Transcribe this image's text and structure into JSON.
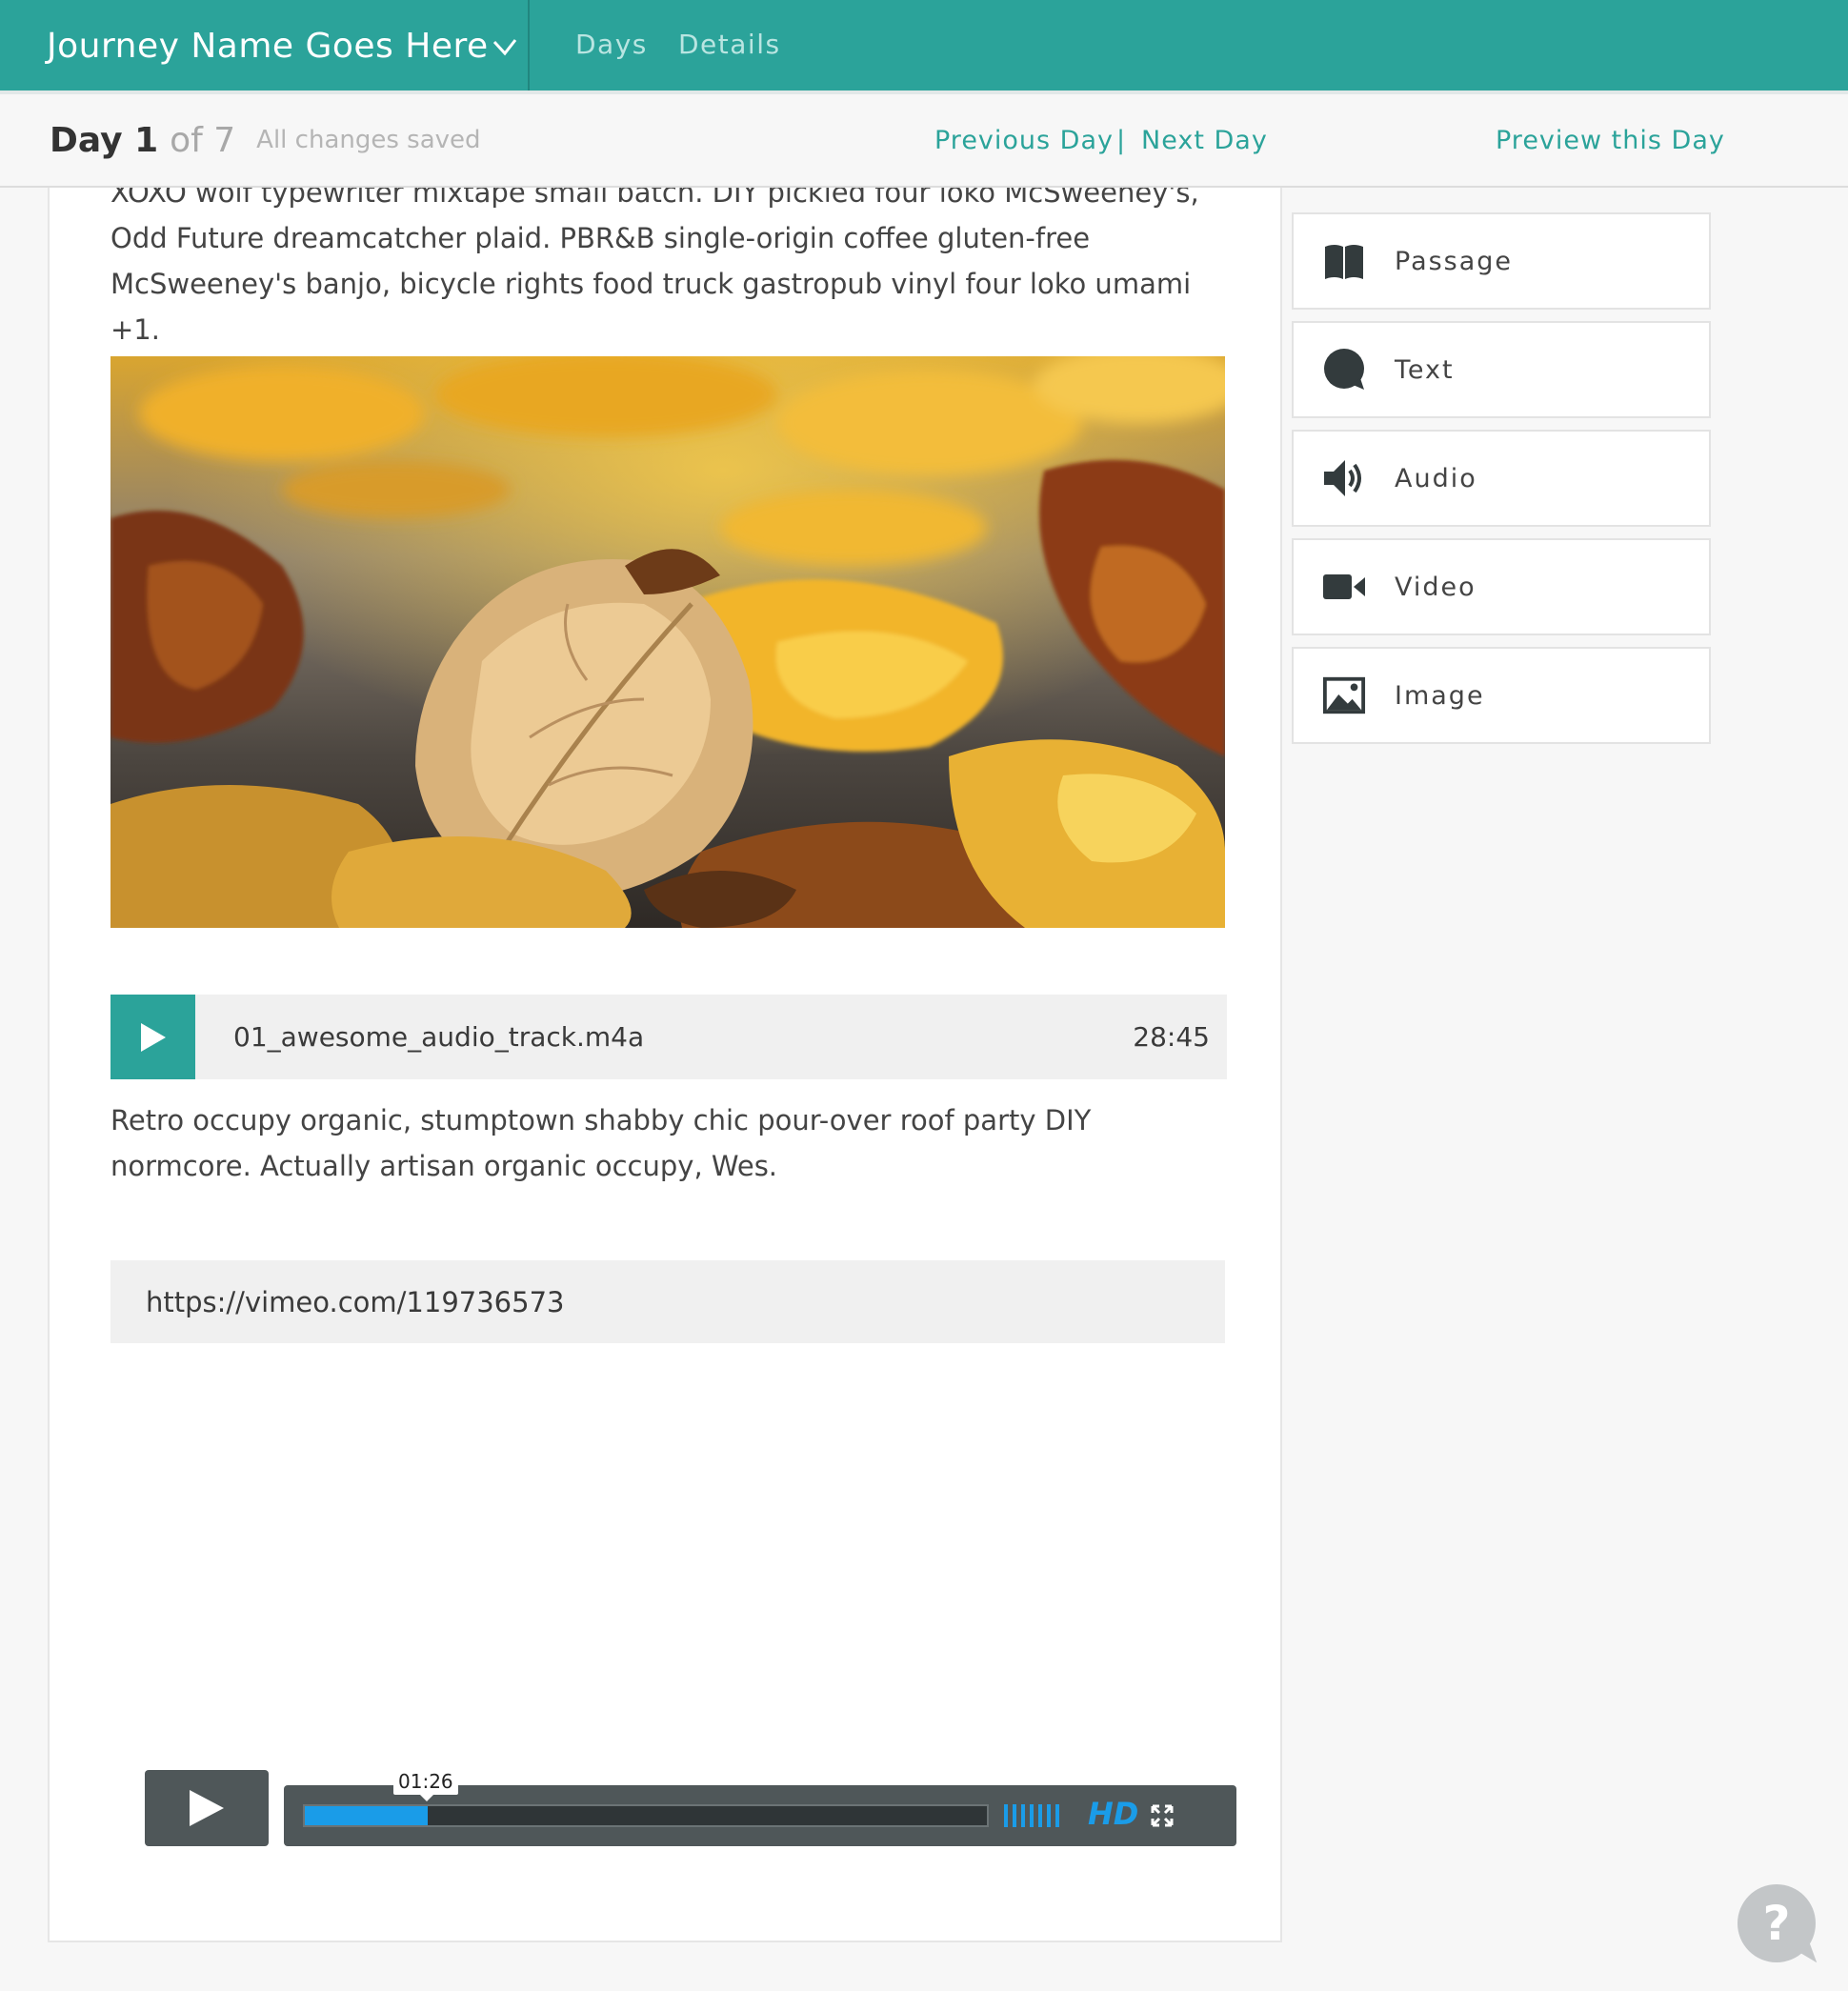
{
  "header": {
    "journey_name": "Journey Name Goes Here",
    "nav": {
      "days": "Days",
      "details": "Details"
    }
  },
  "subheader": {
    "day_label": "Day 1",
    "of_label": "of 7",
    "save_status": "All changes saved",
    "previous_day": "Previous Day",
    "separator": "|",
    "next_day": "Next Day",
    "preview": "Preview this Day"
  },
  "content": {
    "paragraph_1": "XOXO wolf typewriter mixtape small batch. DIY pickled four loko McSweeney's, Odd Future dreamcatcher plaid. PBR&B single-origin coffee gluten-free McSweeney's banjo, bicycle rights food truck gastropub vinyl four loko umami +1.",
    "audio": {
      "filename": "01_awesome_audio_track.m4a",
      "duration": "28:45"
    },
    "paragraph_2": "Retro occupy organic, stumptown shabby chic pour-over roof party DIY normcore. Actually artisan organic occupy, Wes.",
    "video_url": "https://vimeo.com/119736573",
    "video_player": {
      "current_time": "01:26",
      "progress": 0.18,
      "hd_label": "HD"
    }
  },
  "sidebar": {
    "blocks": [
      {
        "label": "Passage",
        "icon": "book-icon"
      },
      {
        "label": "Text",
        "icon": "speech-bubble-icon"
      },
      {
        "label": "Audio",
        "icon": "speaker-icon"
      },
      {
        "label": "Video",
        "icon": "video-camera-icon"
      },
      {
        "label": "Image",
        "icon": "image-icon"
      }
    ]
  },
  "help": {
    "label": "?"
  },
  "colors": {
    "brand": "#2ba39a",
    "video_accent": "#1a9ce8"
  }
}
